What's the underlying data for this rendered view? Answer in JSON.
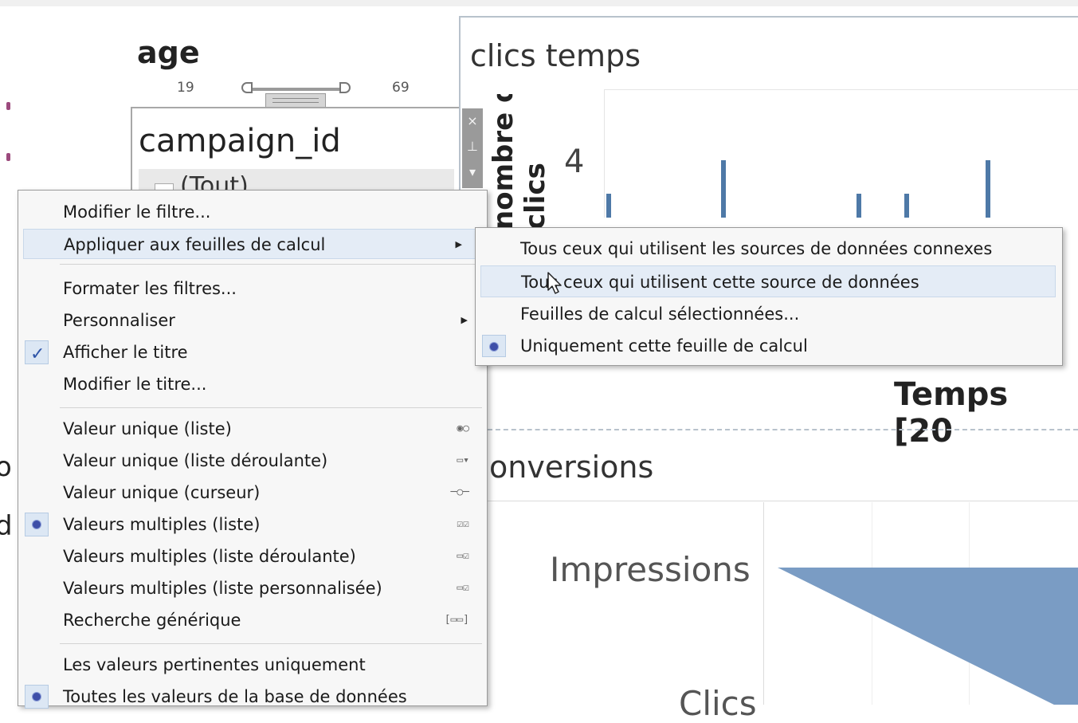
{
  "age_filter": {
    "title": "age",
    "min": "19",
    "max": "69"
  },
  "campaign_filter": {
    "title": "campaign_id",
    "list_first_item": "(Tout)"
  },
  "side_tools": {
    "close": "×",
    "pin": "⊥",
    "menu": "▾"
  },
  "chart": {
    "title": "clics temps",
    "ylabel_line1": "nombre de",
    "ylabel_line2": "clics",
    "y_tick": "4",
    "xlabel": "Temps [20"
  },
  "funnel": {
    "title": "onversions",
    "categories": [
      "Impressions",
      "Clics"
    ]
  },
  "left_fragments": [
    "o",
    "d"
  ],
  "chart_data": {
    "type": "bar",
    "title": "clics temps",
    "ylabel": "nombre de clics",
    "xlabel": "Temps [20",
    "y_ticks": [
      4
    ],
    "values": [
      3,
      4,
      3,
      3,
      4
    ],
    "ylim": [
      0,
      4.5
    ]
  },
  "context_menu": {
    "items": [
      {
        "label": "Modifier le filtre..."
      },
      {
        "label": "Appliquer aux feuilles de calcul",
        "submenu": true,
        "highlighted": true
      },
      {
        "label": "Formater les filtres..."
      },
      {
        "label": "Personnaliser",
        "submenu": true
      },
      {
        "label": "Afficher le titre",
        "checked": true
      },
      {
        "label": "Modifier le titre..."
      },
      {
        "label": "Valeur unique (liste)",
        "icon": "radio-list-icon"
      },
      {
        "label": "Valeur unique (liste déroulante)",
        "icon": "dropdown-icon"
      },
      {
        "label": "Valeur unique (curseur)",
        "icon": "slider-icon"
      },
      {
        "label": "Valeurs multiples (liste)",
        "icon": "checkbox-list-icon",
        "selected": true
      },
      {
        "label": "Valeurs multiples (liste déroulante)",
        "icon": "checkbox-dropdown-icon"
      },
      {
        "label": "Valeurs multiples (liste personnalisée)",
        "icon": "custom-list-icon"
      },
      {
        "label": "Recherche générique",
        "icon": "search-field-icon"
      },
      {
        "label": "Les valeurs pertinentes uniquement"
      },
      {
        "label": "Toutes les valeurs de la base de données",
        "selected": true
      }
    ]
  },
  "submenu": {
    "items": [
      {
        "label": "Tous ceux qui utilisent les sources de données connexes"
      },
      {
        "label": "Tous ceux qui utilisent cette source de données",
        "highlighted": true
      },
      {
        "label": "Feuilles de calcul sélectionnées..."
      },
      {
        "label": "Uniquement cette feuille de calcul",
        "selected": true
      }
    ]
  },
  "colors": {
    "bar": "#4e79a7",
    "funnel": "#7a9cc4",
    "highlight": "#e4ecf6",
    "radio": "#3e4fa8"
  }
}
